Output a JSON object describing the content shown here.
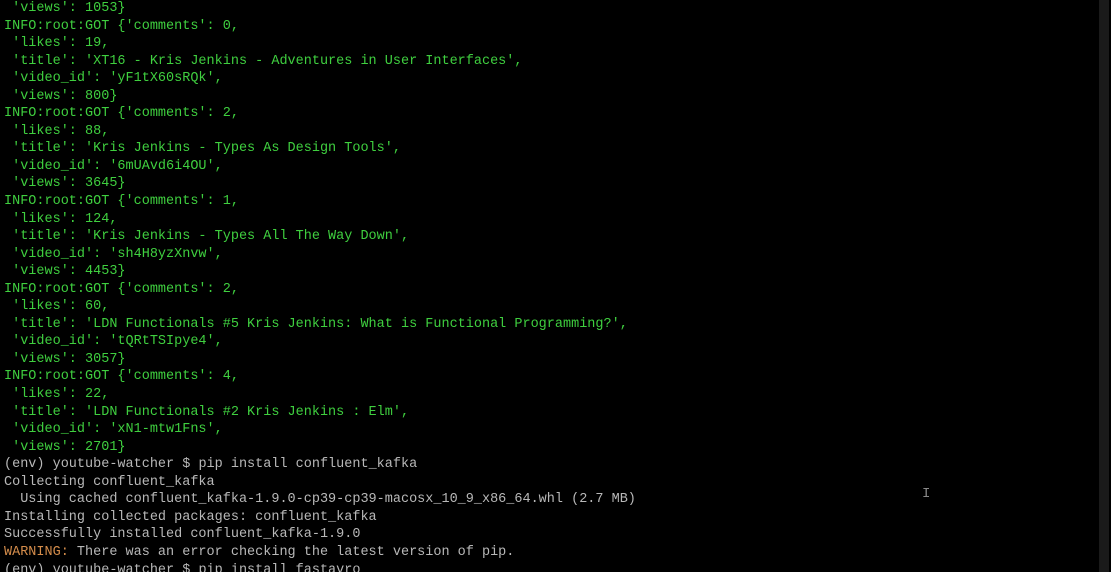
{
  "lines": [
    {
      "cls": "green",
      "text": " 'views': 1053}"
    },
    {
      "cls": "green",
      "text": "INFO:root:GOT {'comments': 0,"
    },
    {
      "cls": "green",
      "text": " 'likes': 19,"
    },
    {
      "cls": "green",
      "text": " 'title': 'XT16 - Kris Jenkins - Adventures in User Interfaces',"
    },
    {
      "cls": "green",
      "text": " 'video_id': 'yF1tX60sRQk',"
    },
    {
      "cls": "green",
      "text": " 'views': 800}"
    },
    {
      "cls": "green",
      "text": "INFO:root:GOT {'comments': 2,"
    },
    {
      "cls": "green",
      "text": " 'likes': 88,"
    },
    {
      "cls": "green",
      "text": " 'title': 'Kris Jenkins - Types As Design Tools',"
    },
    {
      "cls": "green",
      "text": " 'video_id': '6mUAvd6i4OU',"
    },
    {
      "cls": "green",
      "text": " 'views': 3645}"
    },
    {
      "cls": "green",
      "text": "INFO:root:GOT {'comments': 1,"
    },
    {
      "cls": "green",
      "text": " 'likes': 124,"
    },
    {
      "cls": "green",
      "text": " 'title': 'Kris Jenkins - Types All The Way Down',"
    },
    {
      "cls": "green",
      "text": " 'video_id': 'sh4H8yzXnvw',"
    },
    {
      "cls": "green",
      "text": " 'views': 4453}"
    },
    {
      "cls": "green",
      "text": "INFO:root:GOT {'comments': 2,"
    },
    {
      "cls": "green",
      "text": " 'likes': 60,"
    },
    {
      "cls": "green",
      "text": " 'title': 'LDN Functionals #5 Kris Jenkins: What is Functional Programming?',"
    },
    {
      "cls": "green",
      "text": " 'video_id': 'tQRtTSIpye4',"
    },
    {
      "cls": "green",
      "text": " 'views': 3057}"
    },
    {
      "cls": "green",
      "text": "INFO:root:GOT {'comments': 4,"
    },
    {
      "cls": "green",
      "text": " 'likes': 22,"
    },
    {
      "cls": "green",
      "text": " 'title': 'LDN Functionals #2 Kris Jenkins : Elm',"
    },
    {
      "cls": "green",
      "text": " 'video_id': 'xN1-mtw1Fns',"
    },
    {
      "cls": "green",
      "text": " 'views': 2701}"
    }
  ],
  "prompt1": {
    "prefix": "(env) youtube-watcher $ ",
    "cmd": "pip install confluent_kafka"
  },
  "pipout": [
    {
      "cls": "gray",
      "text": "Collecting confluent_kafka"
    },
    {
      "cls": "gray",
      "text": "  Using cached confluent_kafka-1.9.0-cp39-cp39-macosx_10_9_x86_64.whl (2.7 MB)"
    },
    {
      "cls": "gray",
      "text": "Installing collected packages: confluent_kafka"
    },
    {
      "cls": "gray",
      "text": "Successfully installed confluent_kafka-1.9.0"
    }
  ],
  "warning": {
    "label": "WARNING:",
    "rest": " There was an error checking the latest version of pip."
  },
  "prompt2": {
    "prefix": "(env) youtube-watcher $ ",
    "cmd": "pip install fastavro"
  },
  "cursor_glyph": "I"
}
